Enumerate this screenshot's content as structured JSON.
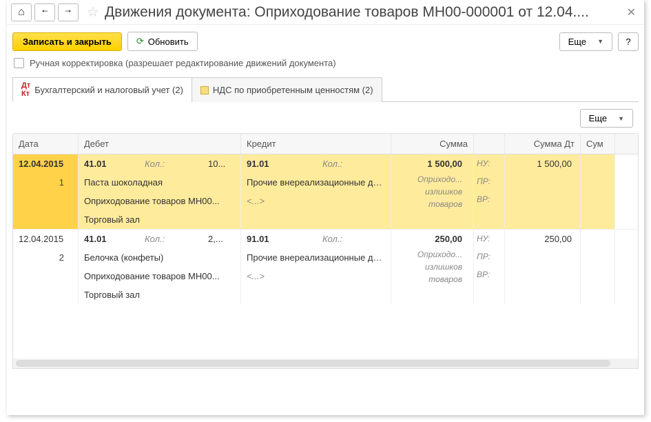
{
  "nav": {
    "back": "←",
    "fwd": "→",
    "home": "⌂"
  },
  "title": "Движения документа: Оприходование товаров МН00-000001 от 12.04....",
  "cmd": {
    "save_close": "Записать и закрыть",
    "refresh": "Обновить",
    "more": "Еще",
    "help": "?"
  },
  "chk_label": "Ручная корректировка (разрешает редактирование движений документа)",
  "tabs": {
    "t1": "Бухгалтерский и налоговый учет (2)",
    "t2": "НДС по приобретенным ценностям (2)"
  },
  "headers": {
    "date": "Дата",
    "debit": "Дебет",
    "credit": "Кредит",
    "sum": "Сумма",
    "sumdt": "Сумма Дт",
    "sum2": "Сум"
  },
  "labels": {
    "kol": "Кол.:",
    "nu": "НУ:",
    "pr": "ПР:",
    "vr": "ВР:"
  },
  "rows": [
    {
      "date": "12.04.2015",
      "idx": "1",
      "deb_acct": "41.01",
      "deb_kolv": "10...",
      "deb_s1": "Паста шоколадная",
      "deb_s2": "Оприходование товаров МН00...",
      "deb_s3": "Торговый зал",
      "cred_acct": "91.01",
      "cred_s1": "Прочие внереализационные до...",
      "cred_s2": "<...>",
      "sum": "1 500,00",
      "sum_desc1": "Оприходо...",
      "sum_desc2": "излишков",
      "sum_desc3": "товаров",
      "sumdt": "1 500,00"
    },
    {
      "date": "12.04.2015",
      "idx": "2",
      "deb_acct": "41.01",
      "deb_kolv": "2,...",
      "deb_s1": "Белочка (конфеты)",
      "deb_s2": "Оприходование товаров МН00...",
      "deb_s3": "Торговый зал",
      "cred_acct": "91.01",
      "cred_s1": "Прочие внереализационные до...",
      "cred_s2": "<...>",
      "sum": "250,00",
      "sum_desc1": "Оприходо...",
      "sum_desc2": "излишков",
      "sum_desc3": "товаров",
      "sumdt": "250,00"
    }
  ]
}
